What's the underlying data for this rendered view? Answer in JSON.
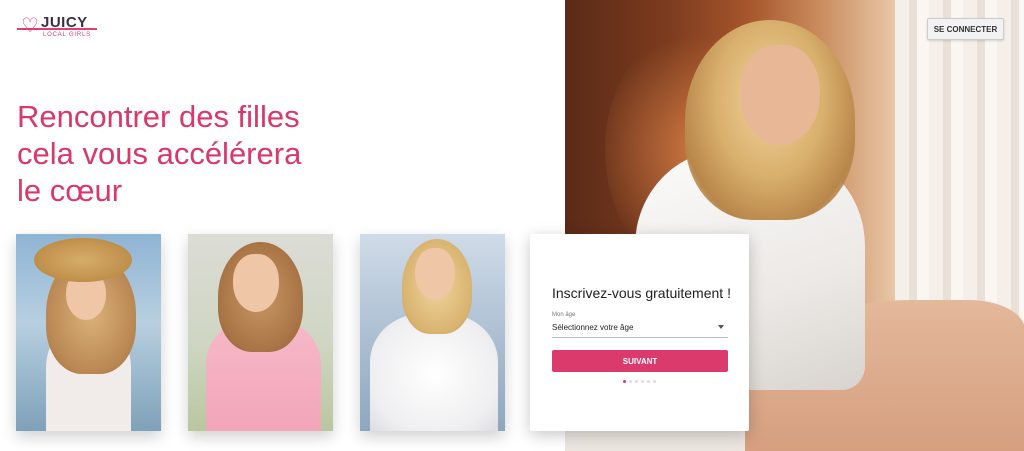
{
  "brand": {
    "name": "JUICY",
    "tagline": "LOCAL GIRLS",
    "accent": "#db3a6c"
  },
  "header": {
    "login_label": "SE CONNECTER"
  },
  "hero": {
    "headline_lines": [
      "Rencontrer des filles",
      "cela vous accélérera",
      "le cœur"
    ]
  },
  "signup": {
    "title": "Inscrivez-vous gratuitement !",
    "age_label": "Mon âge",
    "age_value": "Sélectionnez votre âge",
    "next_label": "SUIVANT",
    "steps_total": 6,
    "current_step": 1
  }
}
